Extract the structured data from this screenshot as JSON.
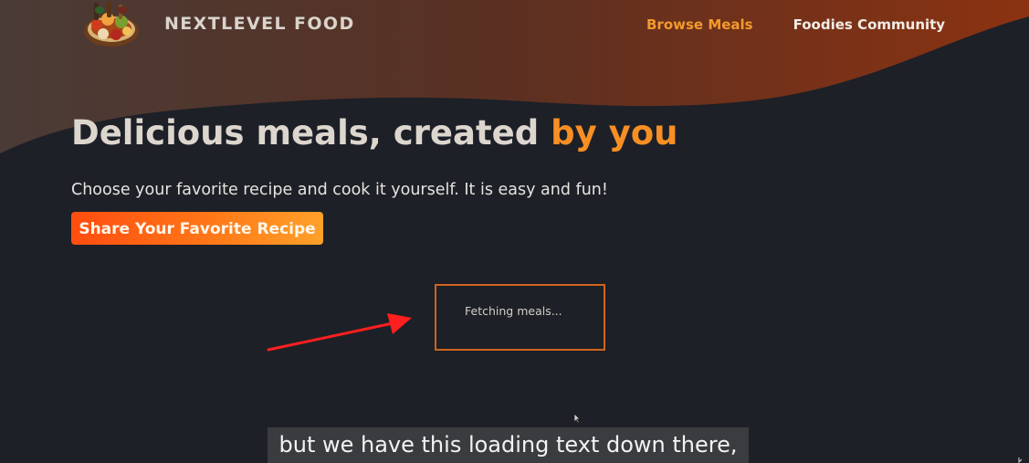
{
  "header": {
    "logo_text": "NEXTLEVEL FOOD",
    "nav": [
      {
        "label": "Browse Meals",
        "active": true
      },
      {
        "label": "Foodies Community",
        "active": false
      }
    ]
  },
  "hero": {
    "title_main": "Delicious meals, created ",
    "title_accent": "by you",
    "subtitle": "Choose your favorite recipe and cook it yourself. It is easy and fun!",
    "cta_label": "Share Your Favorite Recipe"
  },
  "loading": {
    "text": "Fetching meals..."
  },
  "caption": {
    "text": "but we have this loading text down there,"
  },
  "colors": {
    "background": "#1d2027",
    "header_gradient_start": "#4a3b36",
    "header_gradient_end": "#8b3211",
    "accent": "#f78f24",
    "nav_active": "#f39a2c",
    "button_start": "#ff4d10",
    "button_end": "#ffa12a",
    "loading_border": "#cf641d",
    "annotation_arrow": "#ff1f1f",
    "caption_background": "#3a3c40"
  },
  "icons": {
    "logo": "food-platter-icon",
    "arrow": "red-annotation-arrow-icon",
    "cursor": "mouse-pointer-icon"
  }
}
